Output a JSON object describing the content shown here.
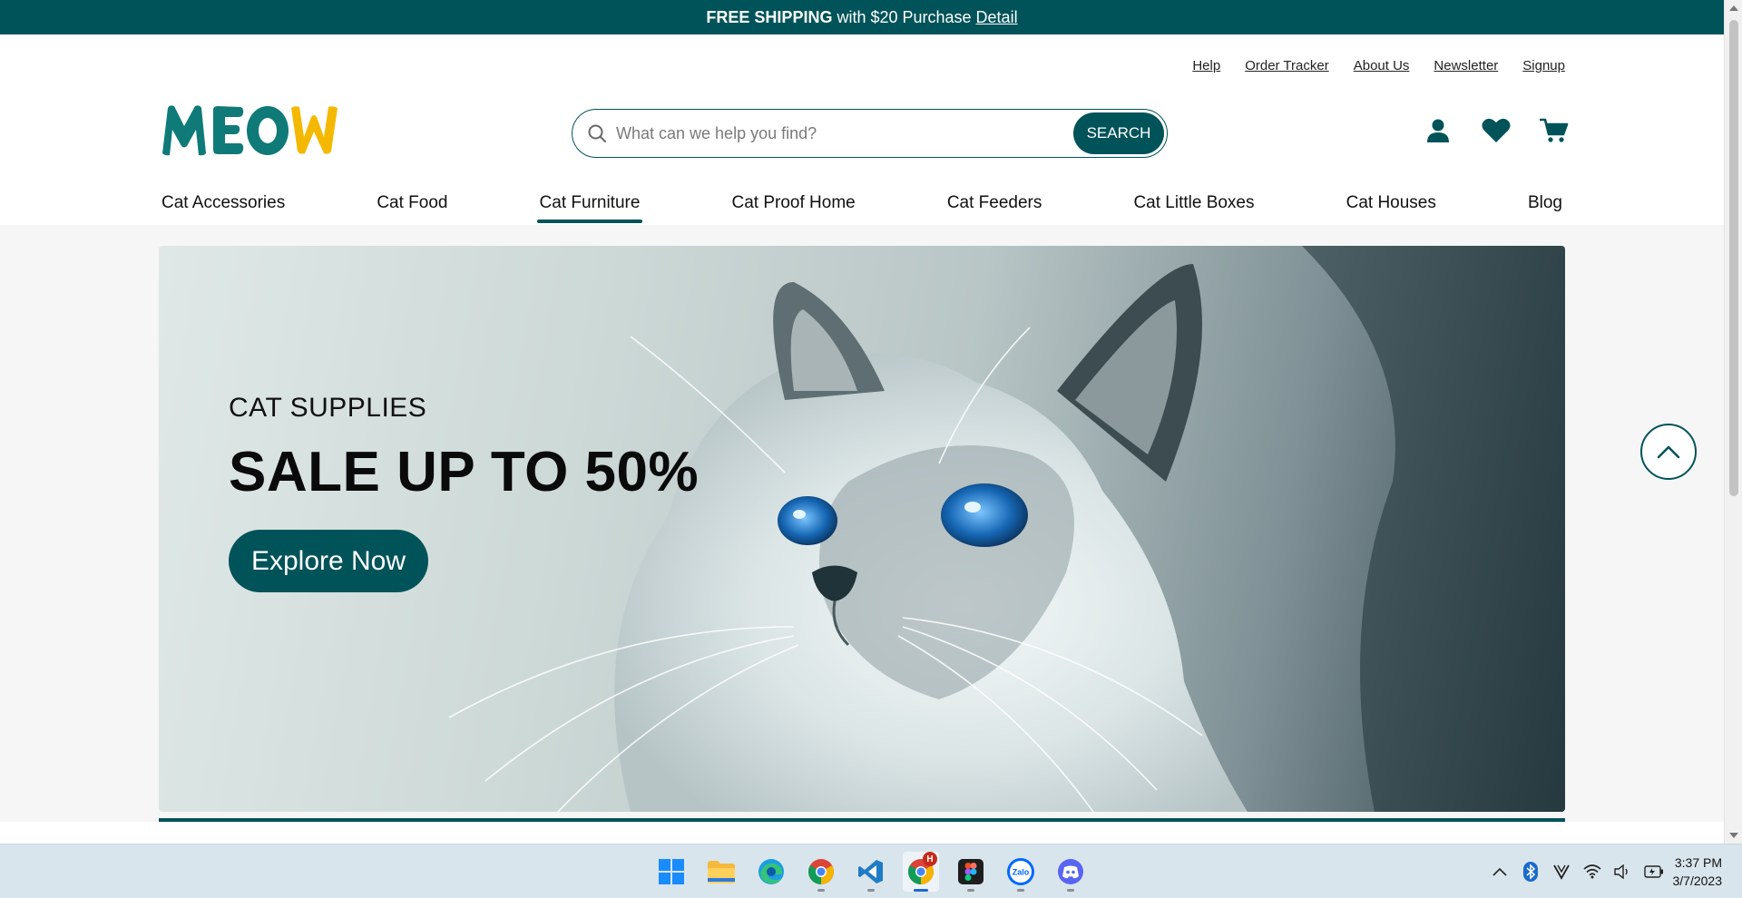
{
  "promo": {
    "strong": "FREE SHIPPING",
    "text": "with $20 Purchase",
    "link": "Detail"
  },
  "utility_links": [
    "Help",
    "Order Tracker",
    "About Us",
    "Newsletter",
    "Signup"
  ],
  "logo": {
    "text": "MEOW",
    "colors": {
      "main": "#0f7a78",
      "accent": "#f5b800"
    }
  },
  "search": {
    "placeholder": "What can we help you find?",
    "value": "",
    "button": "SEARCH"
  },
  "header_icons": [
    "account-icon",
    "wishlist-heart-icon",
    "cart-icon"
  ],
  "nav": [
    {
      "label": "Cat Accessories",
      "active": false
    },
    {
      "label": "Cat Food",
      "active": false
    },
    {
      "label": "Cat Furniture",
      "active": true
    },
    {
      "label": "Cat Proof Home",
      "active": false
    },
    {
      "label": "Cat Feeders",
      "active": false
    },
    {
      "label": "Cat Little Boxes",
      "active": false
    },
    {
      "label": "Cat Houses",
      "active": false
    },
    {
      "label": "Blog",
      "active": false
    }
  ],
  "hero": {
    "eyebrow": "CAT SUPPLIES",
    "headline": "SALE UP TO 50%",
    "cta": "Explore Now"
  },
  "colors": {
    "brand": "#005359",
    "background": "#f6f6f6"
  },
  "taskbar": {
    "apps": [
      "windows-start-icon",
      "file-explorer-icon",
      "edge-icon",
      "chrome-icon",
      "vscode-icon",
      "chrome-profile-icon",
      "figma-icon",
      "zalo-icon",
      "discord-icon"
    ],
    "chrome_profile_badge": "H",
    "zalo_label": "Zalo",
    "tray": [
      "chevron-up-icon",
      "bluetooth-icon",
      "v-app-icon",
      "wifi-icon",
      "volume-icon",
      "battery-icon"
    ],
    "time": "3:37 PM",
    "date": "3/7/2023"
  }
}
